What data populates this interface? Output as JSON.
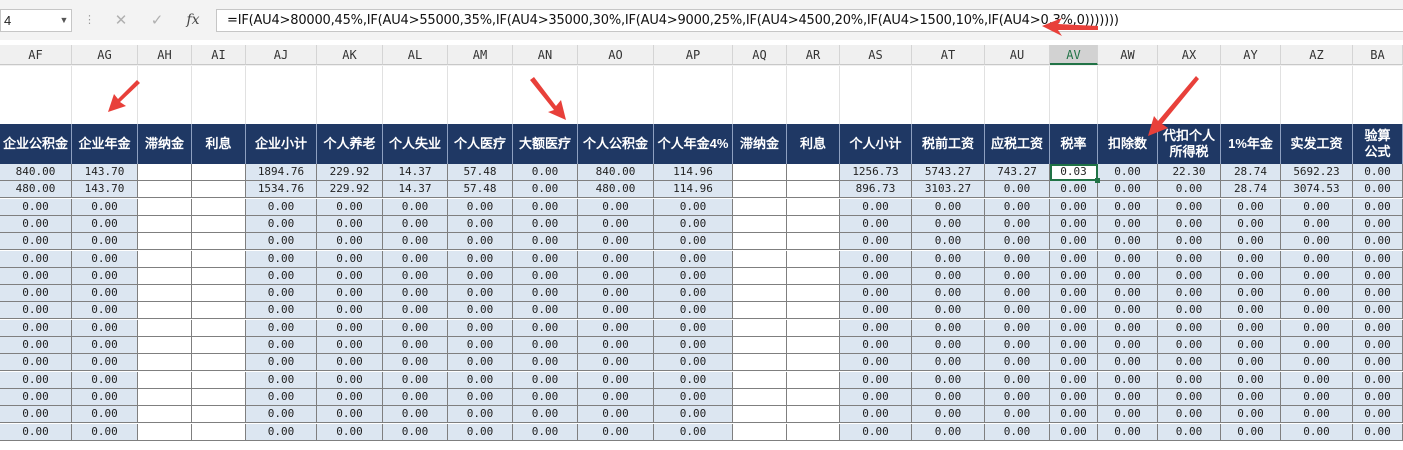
{
  "namebox": {
    "value": "4"
  },
  "formula_bar": {
    "cancel_icon": "close-icon",
    "confirm_icon": "check-icon",
    "fx_label": "fx",
    "formula": "=IF(AU4>80000,45%,IF(AU4>55000,35%,IF(AU4>35000,30%,IF(AU4>9000,25%,IF(AU4>4500,20%,IF(AU4>1500,10%,IF(AU4>0,3%,0)))))))"
  },
  "columns": [
    "AF",
    "AG",
    "AH",
    "AI",
    "AJ",
    "AK",
    "AL",
    "AM",
    "AN",
    "AO",
    "AP",
    "AQ",
    "AR",
    "AS",
    "AT",
    "AU",
    "AV",
    "AW",
    "AX",
    "AY",
    "AZ",
    "BA"
  ],
  "selected_column": "AV",
  "headers": [
    "企业公积金",
    "企业年金",
    "滞纳金",
    "利息",
    "企业小计",
    "个人养老",
    "个人失业",
    "个人医疗",
    "大额医疗",
    "个人公积金",
    "个人年金4%",
    "滞纳金",
    "利息",
    "个人小计",
    "税前工资",
    "应税工资",
    "税率",
    "扣除数",
    "代扣个人\n所得税",
    "1%年金",
    "实发工资",
    "验算\n公式"
  ],
  "rows": [
    [
      "840.00",
      "143.70",
      "",
      "",
      "1894.76",
      "229.92",
      "14.37",
      "57.48",
      "0.00",
      "840.00",
      "114.96",
      "",
      "",
      "1256.73",
      "5743.27",
      "743.27",
      "0.03",
      "0.00",
      "22.30",
      "28.74",
      "5692.23",
      "0.00"
    ],
    [
      "480.00",
      "143.70",
      "",
      "",
      "1534.76",
      "229.92",
      "14.37",
      "57.48",
      "0.00",
      "480.00",
      "114.96",
      "",
      "",
      "896.73",
      "3103.27",
      "0.00",
      "0.00",
      "0.00",
      "0.00",
      "28.74",
      "3074.53",
      "0.00"
    ],
    [
      "0.00",
      "0.00",
      "",
      "",
      "0.00",
      "0.00",
      "0.00",
      "0.00",
      "0.00",
      "0.00",
      "0.00",
      "",
      "",
      "0.00",
      "0.00",
      "0.00",
      "0.00",
      "0.00",
      "0.00",
      "0.00",
      "0.00",
      "0.00"
    ],
    [
      "0.00",
      "0.00",
      "",
      "",
      "0.00",
      "0.00",
      "0.00",
      "0.00",
      "0.00",
      "0.00",
      "0.00",
      "",
      "",
      "0.00",
      "0.00",
      "0.00",
      "0.00",
      "0.00",
      "0.00",
      "0.00",
      "0.00",
      "0.00"
    ],
    [
      "0.00",
      "0.00",
      "",
      "",
      "0.00",
      "0.00",
      "0.00",
      "0.00",
      "0.00",
      "0.00",
      "0.00",
      "",
      "",
      "0.00",
      "0.00",
      "0.00",
      "0.00",
      "0.00",
      "0.00",
      "0.00",
      "0.00",
      "0.00"
    ],
    [
      "0.00",
      "0.00",
      "",
      "",
      "0.00",
      "0.00",
      "0.00",
      "0.00",
      "0.00",
      "0.00",
      "0.00",
      "",
      "",
      "0.00",
      "0.00",
      "0.00",
      "0.00",
      "0.00",
      "0.00",
      "0.00",
      "0.00",
      "0.00"
    ],
    [
      "0.00",
      "0.00",
      "",
      "",
      "0.00",
      "0.00",
      "0.00",
      "0.00",
      "0.00",
      "0.00",
      "0.00",
      "",
      "",
      "0.00",
      "0.00",
      "0.00",
      "0.00",
      "0.00",
      "0.00",
      "0.00",
      "0.00",
      "0.00"
    ],
    [
      "0.00",
      "0.00",
      "",
      "",
      "0.00",
      "0.00",
      "0.00",
      "0.00",
      "0.00",
      "0.00",
      "0.00",
      "",
      "",
      "0.00",
      "0.00",
      "0.00",
      "0.00",
      "0.00",
      "0.00",
      "0.00",
      "0.00",
      "0.00"
    ],
    [
      "0.00",
      "0.00",
      "",
      "",
      "0.00",
      "0.00",
      "0.00",
      "0.00",
      "0.00",
      "0.00",
      "0.00",
      "",
      "",
      "0.00",
      "0.00",
      "0.00",
      "0.00",
      "0.00",
      "0.00",
      "0.00",
      "0.00",
      "0.00"
    ],
    [
      "0.00",
      "0.00",
      "",
      "",
      "0.00",
      "0.00",
      "0.00",
      "0.00",
      "0.00",
      "0.00",
      "0.00",
      "",
      "",
      "0.00",
      "0.00",
      "0.00",
      "0.00",
      "0.00",
      "0.00",
      "0.00",
      "0.00",
      "0.00"
    ],
    [
      "0.00",
      "0.00",
      "",
      "",
      "0.00",
      "0.00",
      "0.00",
      "0.00",
      "0.00",
      "0.00",
      "0.00",
      "",
      "",
      "0.00",
      "0.00",
      "0.00",
      "0.00",
      "0.00",
      "0.00",
      "0.00",
      "0.00",
      "0.00"
    ],
    [
      "0.00",
      "0.00",
      "",
      "",
      "0.00",
      "0.00",
      "0.00",
      "0.00",
      "0.00",
      "0.00",
      "0.00",
      "",
      "",
      "0.00",
      "0.00",
      "0.00",
      "0.00",
      "0.00",
      "0.00",
      "0.00",
      "0.00",
      "0.00"
    ],
    [
      "0.00",
      "0.00",
      "",
      "",
      "0.00",
      "0.00",
      "0.00",
      "0.00",
      "0.00",
      "0.00",
      "0.00",
      "",
      "",
      "0.00",
      "0.00",
      "0.00",
      "0.00",
      "0.00",
      "0.00",
      "0.00",
      "0.00",
      "0.00"
    ],
    [
      "0.00",
      "0.00",
      "",
      "",
      "0.00",
      "0.00",
      "0.00",
      "0.00",
      "0.00",
      "0.00",
      "0.00",
      "",
      "",
      "0.00",
      "0.00",
      "0.00",
      "0.00",
      "0.00",
      "0.00",
      "0.00",
      "0.00",
      "0.00"
    ],
    [
      "0.00",
      "0.00",
      "",
      "",
      "0.00",
      "0.00",
      "0.00",
      "0.00",
      "0.00",
      "0.00",
      "0.00",
      "",
      "",
      "0.00",
      "0.00",
      "0.00",
      "0.00",
      "0.00",
      "0.00",
      "0.00",
      "0.00",
      "0.00"
    ],
    [
      "0.00",
      "0.00",
      "",
      "",
      "0.00",
      "0.00",
      "0.00",
      "0.00",
      "0.00",
      "0.00",
      "0.00",
      "",
      "",
      "0.00",
      "0.00",
      "0.00",
      "0.00",
      "0.00",
      "0.00",
      "0.00",
      "0.00",
      "0.00"
    ]
  ],
  "colors": {
    "header_bg": "#1f3864",
    "data_fill": "#dce6f1",
    "selection": "#217346",
    "arrow": "#e8403a"
  }
}
